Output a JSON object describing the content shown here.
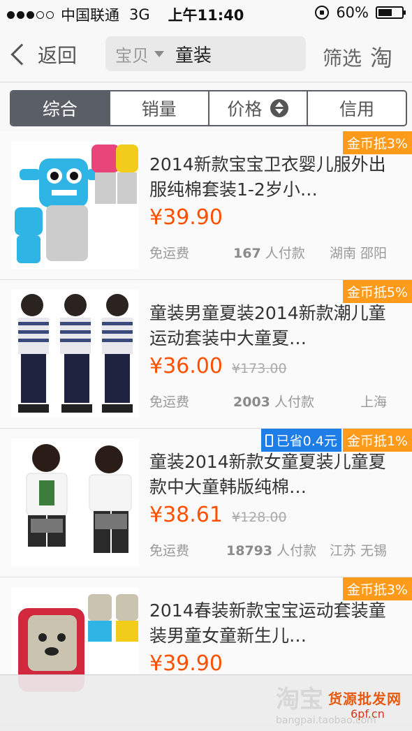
{
  "status_bar": {
    "carrier": "中国联通",
    "network": "3G",
    "time": "上午11:40",
    "battery_text": "60%",
    "battery_level": 0.6,
    "signal_bars_filled": 3
  },
  "nav": {
    "back_label": "返回",
    "search_category": "宝贝",
    "search_query": "童装",
    "filter_label": "筛选",
    "taobao_glyph": "淘"
  },
  "tabs": [
    "综合",
    "销量",
    "价格",
    "信用"
  ],
  "items": [
    {
      "title": "2014新款宝宝卫衣婴儿服外出服纯棉套装1-2岁小…",
      "price": "¥39.90",
      "original_price": "",
      "shipping": "免运费",
      "sold_count": "167",
      "sold_label": "人付款",
      "location": "湖南 邵阳",
      "badge_saved": "",
      "badge_coin": "金币抵3%"
    },
    {
      "title": "童装男童夏装2014新款潮儿童运动套装中大童夏…",
      "price": "¥36.00",
      "original_price": "¥173.00",
      "shipping": "免运费",
      "sold_count": "2003",
      "sold_label": "人付款",
      "location": "上海",
      "badge_saved": "",
      "badge_coin": "金币抵5%"
    },
    {
      "title": "童装2014新款女童夏装儿童夏款中大童韩版纯棉…",
      "price": "¥38.61",
      "original_price": "¥128.00",
      "shipping": "免运费",
      "sold_count": "18793",
      "sold_label": "人付款",
      "location": "江苏 无锡",
      "badge_saved": "已省0.4元",
      "badge_coin": "金币抵1%"
    },
    {
      "title": "2014春装新款宝宝运动套装童装男童女童新生儿…",
      "price": "¥39.90",
      "original_price": "",
      "shipping": "",
      "sold_count": "",
      "sold_label": "",
      "location": "",
      "badge_saved": "",
      "badge_coin": "金币抵3%"
    }
  ],
  "watermark": {
    "left": "淘宝",
    "right_top": "货源批发网",
    "right_bottom": "6pf.cn",
    "url": "bangpai.taobao.com"
  },
  "colors": {
    "price": "#ff5000",
    "coin_badge": "#ff9a1a",
    "saved_badge": "#1e7de6",
    "tab_active": "#5a5e66"
  }
}
